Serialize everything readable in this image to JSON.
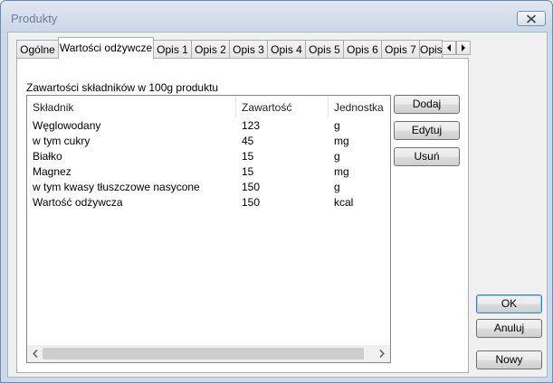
{
  "window": {
    "title": "Produkty",
    "close_icon": "close-icon"
  },
  "tabs": [
    {
      "label": "Ogólne",
      "active": false
    },
    {
      "label": "Wartości odżywcze",
      "active": true
    },
    {
      "label": "Opis 1",
      "active": false
    },
    {
      "label": "Opis 2",
      "active": false
    },
    {
      "label": "Opis 3",
      "active": false
    },
    {
      "label": "Opis 4",
      "active": false
    },
    {
      "label": "Opis 5",
      "active": false
    },
    {
      "label": "Opis 6",
      "active": false
    },
    {
      "label": "Opis 7",
      "active": false
    },
    {
      "label": "Opis",
      "active": false
    }
  ],
  "tab_scroll": {
    "left_icon": "scroll-left-icon",
    "right_icon": "scroll-right-icon"
  },
  "nutrition": {
    "section_label": "Zawartości składników w 100g produktu",
    "columns": [
      "Składnik",
      "Zawartość",
      "Jednostka"
    ],
    "rows": [
      {
        "name": "Węglowodany",
        "value": "123",
        "unit": "g"
      },
      {
        "name": "w tym cukry",
        "value": "45",
        "unit": "mg"
      },
      {
        "name": "Białko",
        "value": "15",
        "unit": "g"
      },
      {
        "name": "Magnez",
        "value": "15",
        "unit": "mg"
      },
      {
        "name": "w tym kwasy tłuszczowe nasycone",
        "value": "150",
        "unit": "g"
      },
      {
        "name": "Wartość odżywcza",
        "value": "150",
        "unit": "kcal"
      }
    ]
  },
  "side_buttons": {
    "add": "Dodaj",
    "edit": "Edytuj",
    "remove": "Usuń"
  },
  "dialog_buttons": {
    "ok": "OK",
    "cancel": "Anuluj",
    "new": "Nowy"
  }
}
